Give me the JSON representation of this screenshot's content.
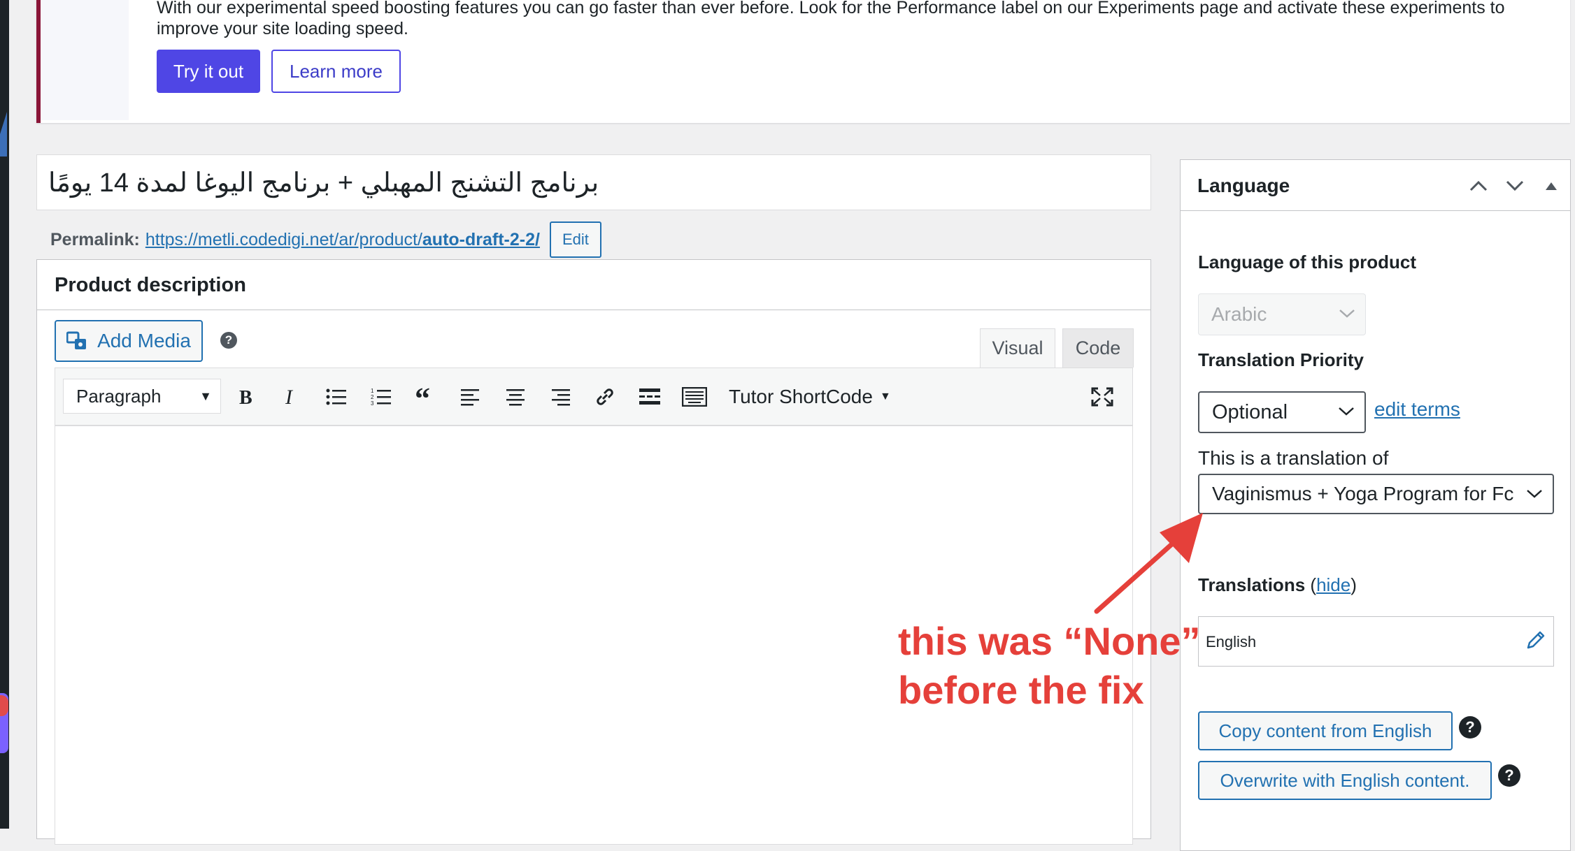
{
  "notice": {
    "text": "With our experimental speed boosting features you can go faster than ever before. Look for the Performance label on our Experiments page and activate these experiments to improve your site loading speed.",
    "try_label": "Try it out",
    "learn_label": "Learn more",
    "accent_color": "#8a1538",
    "button_color": "#4f46e5"
  },
  "title": {
    "value": "برنامج التشنج المهبلي + برنامج اليوغا لمدة 14 يومًا"
  },
  "permalink": {
    "label": "Permalink:",
    "url_prefix": "https://metli.codedigi.net/ar/product/",
    "url_slug": "auto-draft-2-2/",
    "edit_label": "Edit"
  },
  "editor": {
    "heading": "Product description",
    "add_media_label": "Add Media",
    "help_symbol": "?",
    "tabs": [
      {
        "label": "Visual",
        "active": true
      },
      {
        "label": "Code",
        "active": false
      }
    ],
    "format_value": "Paragraph",
    "shortcode_label": "Tutor ShortCode",
    "toolbar_icons": [
      "bold-icon",
      "italic-icon",
      "bullet-list-icon",
      "numbered-list-icon",
      "blockquote-icon",
      "align-left-icon",
      "align-center-icon",
      "align-right-icon",
      "link-icon",
      "read-more-icon",
      "toolbar-toggle-icon",
      "fullscreen-icon"
    ]
  },
  "language_panel": {
    "title": "Language",
    "language_label": "Language of this product",
    "language_value": "Arabic",
    "priority_label": "Translation Priority",
    "priority_value": "Optional",
    "edit_terms_label": "edit terms",
    "translation_of_label": "This is a translation of",
    "translation_of_value": "Vaginismus + Yoga Program for Fc",
    "translations_label": "Translations",
    "hide_label": "hide",
    "paren_open": "(",
    "paren_close": ")",
    "translation_language": "English",
    "copy_label": "Copy content from English",
    "overwrite_label": "Overwrite with English content.",
    "help_symbol": "?"
  },
  "annotation": {
    "line1": "this was “None”",
    "line2": "before the fix",
    "color": "#e5403a"
  }
}
